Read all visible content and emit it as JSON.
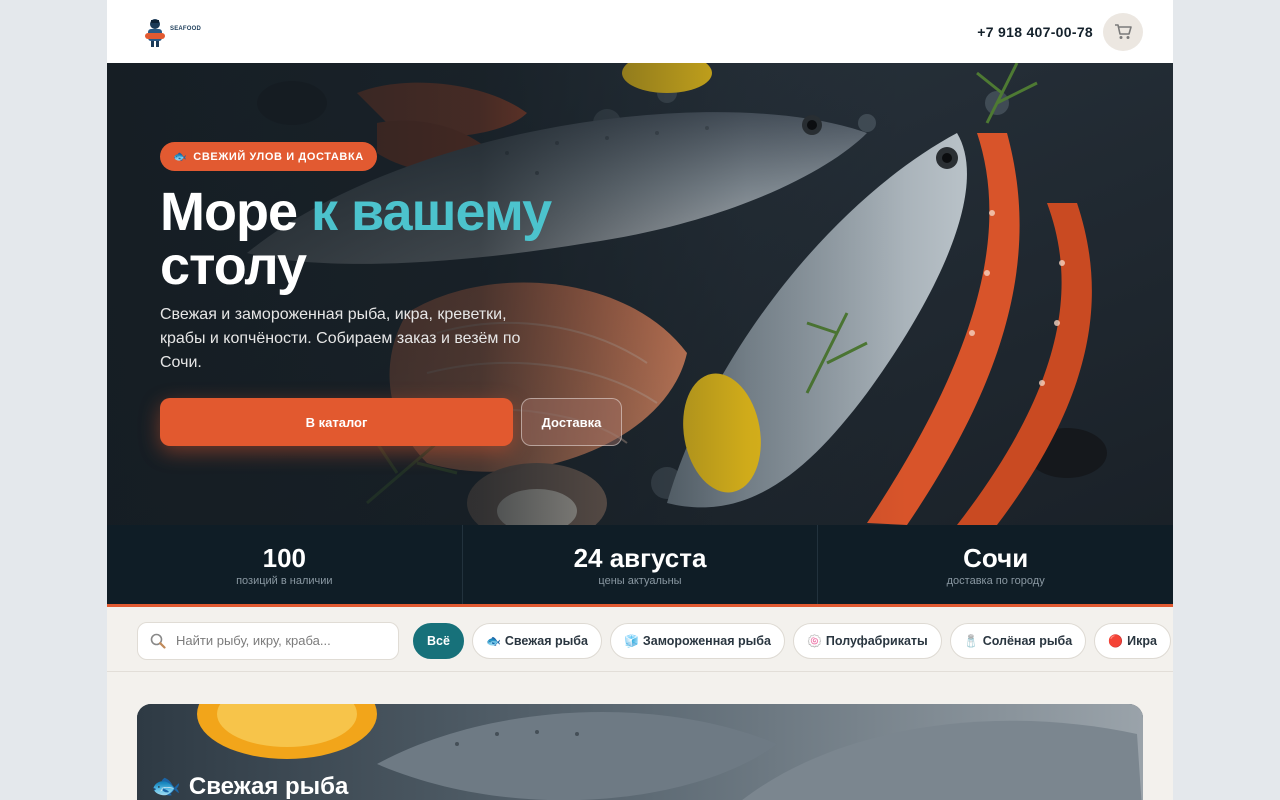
{
  "header": {
    "logo_text": "SEAFOOD",
    "phone": "+7 918 407-00-78",
    "cart_icon": "cart-icon"
  },
  "hero": {
    "badge": "СВЕЖИЙ УЛОВ И ДОСТАВКА",
    "title_part1": "Море ",
    "title_accent": "к вашему",
    "title_part2": "столу",
    "subtitle": "Свежая и замороженная рыба, икра, креветки, крабы и копчёности. Собираем заказ и везём по Сочи.",
    "primary_button": "В каталог",
    "secondary_button": "Доставка"
  },
  "stats": [
    {
      "value": "100",
      "label": "позиций в наличии"
    },
    {
      "value": "24 августа",
      "label": "цены актуальны"
    },
    {
      "value": "Сочи",
      "label": "доставка по городу"
    }
  ],
  "filters": {
    "search_placeholder": "Найти рыбу, икру, краба...",
    "chips": [
      {
        "label": "Всё",
        "active": true,
        "icon": ""
      },
      {
        "label": "Свежая рыба",
        "active": false,
        "icon": "🐟"
      },
      {
        "label": "Замороженная рыба",
        "active": false,
        "icon": "🧊"
      },
      {
        "label": "Полуфабрикаты",
        "active": false,
        "icon": "🍥"
      },
      {
        "label": "Солёная рыба",
        "active": false,
        "icon": "🧂"
      },
      {
        "label": "Икра",
        "active": false,
        "icon": "🔴"
      }
    ]
  },
  "category": {
    "title": "Свежая рыба",
    "icon": "🐟"
  },
  "colors": {
    "accent": "#e25a31",
    "teal": "#17717a",
    "title_accent": "#4cc3cd",
    "dark": "#0f1d26"
  }
}
